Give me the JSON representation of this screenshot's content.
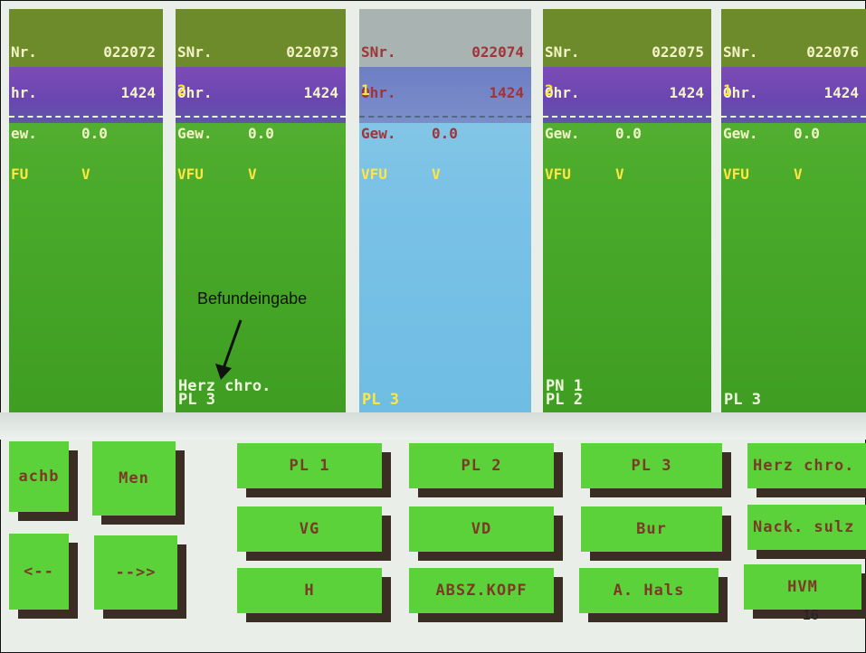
{
  "columns": [
    {
      "snr_label": "Nr.",
      "snr": "022072",
      "ohr_label": "hr.",
      "ohr": "1424",
      "gew_label": "ew.",
      "gew": "0.0",
      "vfu_label": "FU",
      "vfu": "V",
      "vfu_num": "",
      "bottom1": "",
      "bottom2": ""
    },
    {
      "snr_label": "SNr.",
      "snr": "022073",
      "ohr_label": "Ohr.",
      "ohr": "1424",
      "gew_label": "Gew.",
      "gew": "0.0",
      "vfu_label": "VFU",
      "vfu": "V",
      "vfu_num": "2",
      "bottom1": "Herz chro.",
      "bottom2": "PL 3"
    },
    {
      "snr_label": "SNr.",
      "snr": "022074",
      "ohr_label": "Ohr.",
      "ohr": "1424",
      "gew_label": "Gew.",
      "gew": "0.0",
      "vfu_label": "VFU",
      "vfu": "V",
      "vfu_num": "1",
      "bottom1": "",
      "bottom2": "PL 3"
    },
    {
      "snr_label": "SNr.",
      "snr": "022075",
      "ohr_label": "Ohr.",
      "ohr": "1424",
      "gew_label": "Gew.",
      "gew": "0.0",
      "vfu_label": "VFU",
      "vfu": "V",
      "vfu_num": "2",
      "bottom1": "PN 1",
      "bottom2": "PL 2"
    },
    {
      "snr_label": "SNr.",
      "snr": "022076",
      "ohr_label": "Ohr.",
      "ohr": "1424",
      "gew_label": "Gew.",
      "gew": "0.0",
      "vfu_label": "VFU",
      "vfu": "V",
      "vfu_num": "1",
      "bottom1": "",
      "bottom2": "PL 3"
    }
  ],
  "annotation": "Befundeingabe",
  "buttons": {
    "nachb": "achb",
    "men": "Men",
    "back": "<--",
    "fwd": "-->>",
    "pl1": "PL 1",
    "pl2": "PL 2",
    "pl3": "PL 3",
    "herz": "Herz chro.",
    "vg": "VG",
    "vd": "VD",
    "bur": "Bur",
    "nack": "Nack. sulz",
    "h": "H",
    "absz": "ABSZ.KOPF",
    "ahals": "A. Hals",
    "hvm": "HVM"
  },
  "page_number": "16",
  "colors": {
    "column_green": "#4aaa2a",
    "selected_blue": "#79c1e6",
    "band_purple": "#6a46b0",
    "button_green": "#5cd23a",
    "button_text": "#7a3a26"
  }
}
